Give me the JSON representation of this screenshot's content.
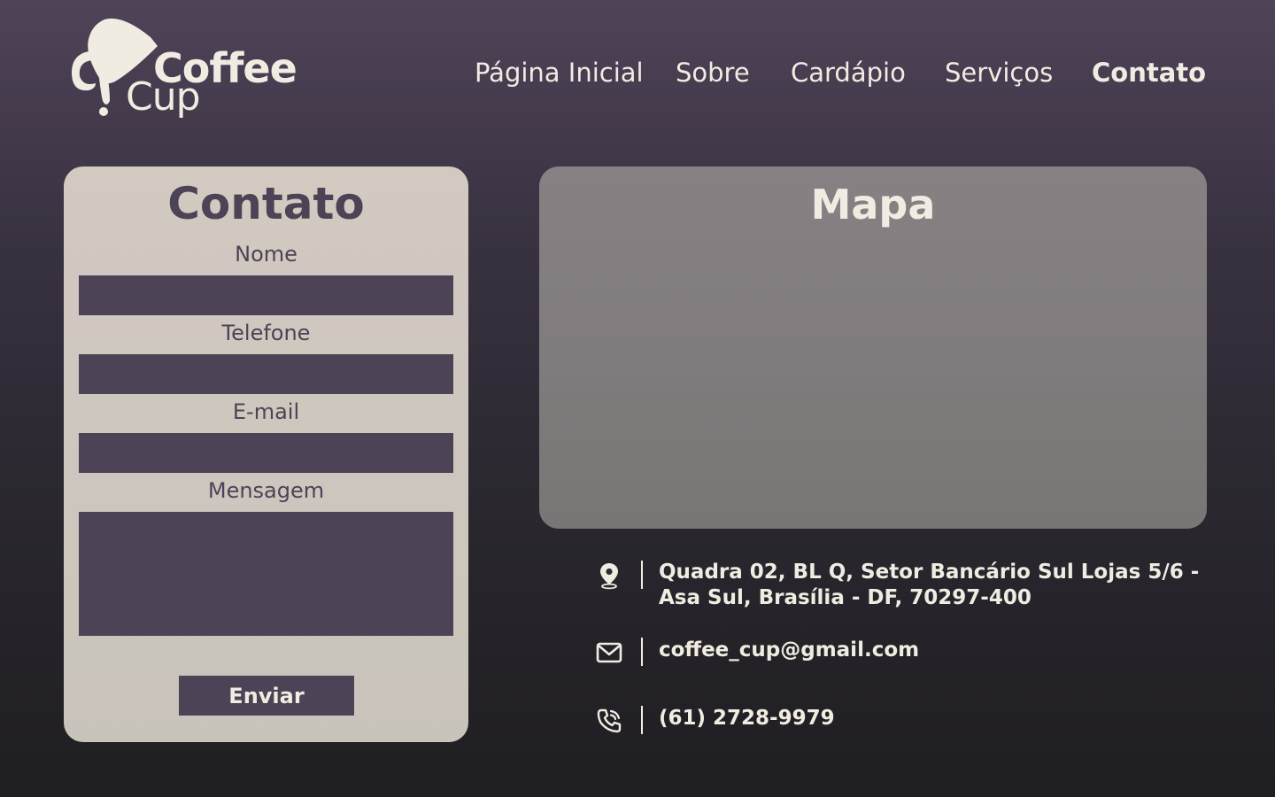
{
  "brand": {
    "name_line1": "Coffee",
    "name_line2": "Cup"
  },
  "nav": {
    "items": [
      {
        "label": "Página Inicial",
        "active": false
      },
      {
        "label": "Sobre",
        "active": false
      },
      {
        "label": "Cardápio",
        "active": false
      },
      {
        "label": "Serviços",
        "active": false
      },
      {
        "label": "Contato",
        "active": true
      }
    ]
  },
  "contact_form": {
    "title": "Contato",
    "fields": {
      "name_label": "Nome",
      "phone_label": "Telefone",
      "email_label": "E-mail",
      "message_label": "Mensagem"
    },
    "values": {
      "name": "",
      "phone": "",
      "email": "",
      "message": ""
    },
    "submit_label": "Enviar"
  },
  "map": {
    "title": "Mapa"
  },
  "info": {
    "address_line1": "Quadra 02, BL Q, Setor Bancário Sul Lojas 5/6 -",
    "address_line2": "Asa Sul, Brasília - DF, 70297-400",
    "email": "coffee_cup@gmail.com",
    "phone": "(61) 2728-9979",
    "icons": [
      "location-pin-icon",
      "mail-icon",
      "phone-icon"
    ]
  },
  "colors": {
    "cream": "#f1ece2",
    "purple": "#4d4356",
    "card_bg": "#cfc8bf",
    "map_bg": "#807b7c"
  }
}
